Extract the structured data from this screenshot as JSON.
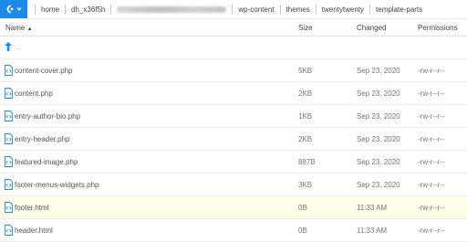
{
  "toolbar": {
    "breadcrumbs": [
      "home",
      "dh_x36f5h",
      "wp-content",
      "themes",
      "twentytwenty",
      "template-parts"
    ]
  },
  "columns": {
    "name": "Name",
    "size": "Size",
    "changed": "Changed",
    "permissions": "Permissions"
  },
  "parent_dir_label": "..",
  "files": [
    {
      "name": "content-cover.php",
      "size": "5KB",
      "changed": "Sep 23, 2020",
      "perm": "-rw-r--r--"
    },
    {
      "name": "content.php",
      "size": "2KB",
      "changed": "Sep 23, 2020",
      "perm": "-rw-r--r--"
    },
    {
      "name": "entry-author-bio.php",
      "size": "1KB",
      "changed": "Sep 23, 2020",
      "perm": "-rw-r--r--"
    },
    {
      "name": "entry-header.php",
      "size": "2KB",
      "changed": "Sep 23, 2020",
      "perm": "-rw-r--r--"
    },
    {
      "name": "featured-image.php",
      "size": "887B",
      "changed": "Sep 23, 2020",
      "perm": "-rw-r--r--"
    },
    {
      "name": "footer-menus-widgets.php",
      "size": "3KB",
      "changed": "Sep 23, 2020",
      "perm": "-rw-r--r--"
    },
    {
      "name": "footer.html",
      "size": "0B",
      "changed": "11:33 AM",
      "perm": "-rw-r--r--"
    },
    {
      "name": "header.html",
      "size": "0B",
      "changed": "11:33 AM",
      "perm": "-rw-r--r--"
    }
  ],
  "colors": {
    "accent": "#1c8ae8",
    "selected_row": "#fdfde8"
  }
}
